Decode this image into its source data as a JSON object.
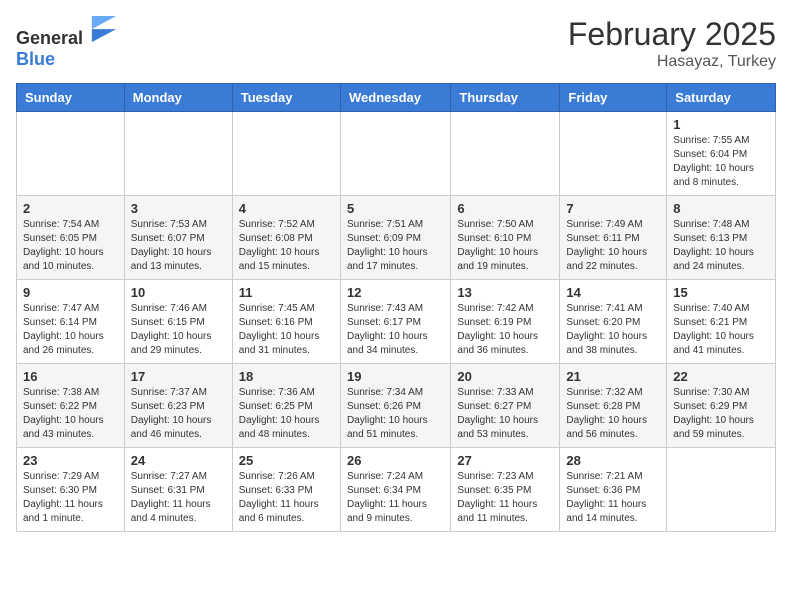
{
  "header": {
    "logo_general": "General",
    "logo_blue": "Blue",
    "month_title": "February 2025",
    "location": "Hasayaz, Turkey"
  },
  "days_of_week": [
    "Sunday",
    "Monday",
    "Tuesday",
    "Wednesday",
    "Thursday",
    "Friday",
    "Saturday"
  ],
  "weeks": [
    [
      {
        "day": "",
        "info": ""
      },
      {
        "day": "",
        "info": ""
      },
      {
        "day": "",
        "info": ""
      },
      {
        "day": "",
        "info": ""
      },
      {
        "day": "",
        "info": ""
      },
      {
        "day": "",
        "info": ""
      },
      {
        "day": "1",
        "info": "Sunrise: 7:55 AM\nSunset: 6:04 PM\nDaylight: 10 hours and 8 minutes."
      }
    ],
    [
      {
        "day": "2",
        "info": "Sunrise: 7:54 AM\nSunset: 6:05 PM\nDaylight: 10 hours and 10 minutes."
      },
      {
        "day": "3",
        "info": "Sunrise: 7:53 AM\nSunset: 6:07 PM\nDaylight: 10 hours and 13 minutes."
      },
      {
        "day": "4",
        "info": "Sunrise: 7:52 AM\nSunset: 6:08 PM\nDaylight: 10 hours and 15 minutes."
      },
      {
        "day": "5",
        "info": "Sunrise: 7:51 AM\nSunset: 6:09 PM\nDaylight: 10 hours and 17 minutes."
      },
      {
        "day": "6",
        "info": "Sunrise: 7:50 AM\nSunset: 6:10 PM\nDaylight: 10 hours and 19 minutes."
      },
      {
        "day": "7",
        "info": "Sunrise: 7:49 AM\nSunset: 6:11 PM\nDaylight: 10 hours and 22 minutes."
      },
      {
        "day": "8",
        "info": "Sunrise: 7:48 AM\nSunset: 6:13 PM\nDaylight: 10 hours and 24 minutes."
      }
    ],
    [
      {
        "day": "9",
        "info": "Sunrise: 7:47 AM\nSunset: 6:14 PM\nDaylight: 10 hours and 26 minutes."
      },
      {
        "day": "10",
        "info": "Sunrise: 7:46 AM\nSunset: 6:15 PM\nDaylight: 10 hours and 29 minutes."
      },
      {
        "day": "11",
        "info": "Sunrise: 7:45 AM\nSunset: 6:16 PM\nDaylight: 10 hours and 31 minutes."
      },
      {
        "day": "12",
        "info": "Sunrise: 7:43 AM\nSunset: 6:17 PM\nDaylight: 10 hours and 34 minutes."
      },
      {
        "day": "13",
        "info": "Sunrise: 7:42 AM\nSunset: 6:19 PM\nDaylight: 10 hours and 36 minutes."
      },
      {
        "day": "14",
        "info": "Sunrise: 7:41 AM\nSunset: 6:20 PM\nDaylight: 10 hours and 38 minutes."
      },
      {
        "day": "15",
        "info": "Sunrise: 7:40 AM\nSunset: 6:21 PM\nDaylight: 10 hours and 41 minutes."
      }
    ],
    [
      {
        "day": "16",
        "info": "Sunrise: 7:38 AM\nSunset: 6:22 PM\nDaylight: 10 hours and 43 minutes."
      },
      {
        "day": "17",
        "info": "Sunrise: 7:37 AM\nSunset: 6:23 PM\nDaylight: 10 hours and 46 minutes."
      },
      {
        "day": "18",
        "info": "Sunrise: 7:36 AM\nSunset: 6:25 PM\nDaylight: 10 hours and 48 minutes."
      },
      {
        "day": "19",
        "info": "Sunrise: 7:34 AM\nSunset: 6:26 PM\nDaylight: 10 hours and 51 minutes."
      },
      {
        "day": "20",
        "info": "Sunrise: 7:33 AM\nSunset: 6:27 PM\nDaylight: 10 hours and 53 minutes."
      },
      {
        "day": "21",
        "info": "Sunrise: 7:32 AM\nSunset: 6:28 PM\nDaylight: 10 hours and 56 minutes."
      },
      {
        "day": "22",
        "info": "Sunrise: 7:30 AM\nSunset: 6:29 PM\nDaylight: 10 hours and 59 minutes."
      }
    ],
    [
      {
        "day": "23",
        "info": "Sunrise: 7:29 AM\nSunset: 6:30 PM\nDaylight: 11 hours and 1 minute."
      },
      {
        "day": "24",
        "info": "Sunrise: 7:27 AM\nSunset: 6:31 PM\nDaylight: 11 hours and 4 minutes."
      },
      {
        "day": "25",
        "info": "Sunrise: 7:26 AM\nSunset: 6:33 PM\nDaylight: 11 hours and 6 minutes."
      },
      {
        "day": "26",
        "info": "Sunrise: 7:24 AM\nSunset: 6:34 PM\nDaylight: 11 hours and 9 minutes."
      },
      {
        "day": "27",
        "info": "Sunrise: 7:23 AM\nSunset: 6:35 PM\nDaylight: 11 hours and 11 minutes."
      },
      {
        "day": "28",
        "info": "Sunrise: 7:21 AM\nSunset: 6:36 PM\nDaylight: 11 hours and 14 minutes."
      },
      {
        "day": "",
        "info": ""
      }
    ]
  ]
}
